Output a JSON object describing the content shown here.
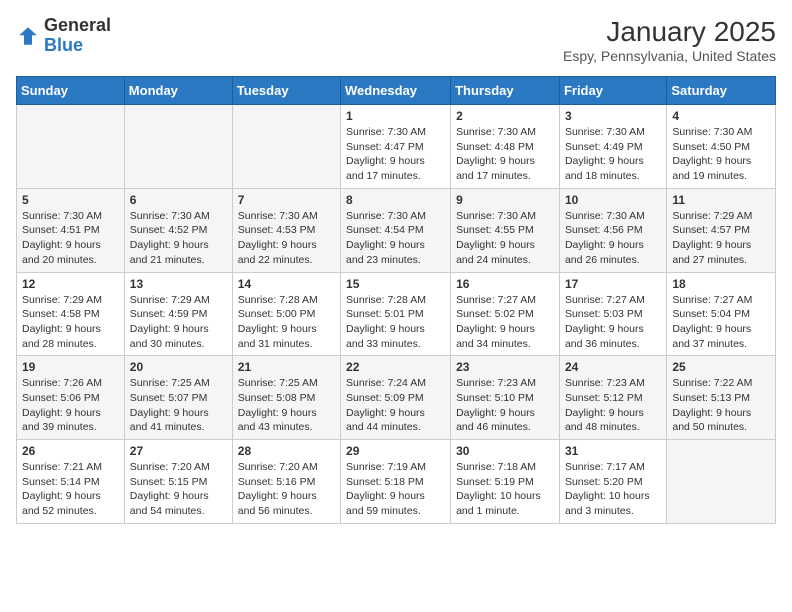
{
  "header": {
    "logo_line1": "General",
    "logo_line2": "Blue",
    "title": "January 2025",
    "subtitle": "Espy, Pennsylvania, United States"
  },
  "days_of_week": [
    "Sunday",
    "Monday",
    "Tuesday",
    "Wednesday",
    "Thursday",
    "Friday",
    "Saturday"
  ],
  "weeks": [
    [
      {
        "day": "",
        "content": ""
      },
      {
        "day": "",
        "content": ""
      },
      {
        "day": "",
        "content": ""
      },
      {
        "day": "1",
        "content": "Sunrise: 7:30 AM\nSunset: 4:47 PM\nDaylight: 9 hours\nand 17 minutes."
      },
      {
        "day": "2",
        "content": "Sunrise: 7:30 AM\nSunset: 4:48 PM\nDaylight: 9 hours\nand 17 minutes."
      },
      {
        "day": "3",
        "content": "Sunrise: 7:30 AM\nSunset: 4:49 PM\nDaylight: 9 hours\nand 18 minutes."
      },
      {
        "day": "4",
        "content": "Sunrise: 7:30 AM\nSunset: 4:50 PM\nDaylight: 9 hours\nand 19 minutes."
      }
    ],
    [
      {
        "day": "5",
        "content": "Sunrise: 7:30 AM\nSunset: 4:51 PM\nDaylight: 9 hours\nand 20 minutes."
      },
      {
        "day": "6",
        "content": "Sunrise: 7:30 AM\nSunset: 4:52 PM\nDaylight: 9 hours\nand 21 minutes."
      },
      {
        "day": "7",
        "content": "Sunrise: 7:30 AM\nSunset: 4:53 PM\nDaylight: 9 hours\nand 22 minutes."
      },
      {
        "day": "8",
        "content": "Sunrise: 7:30 AM\nSunset: 4:54 PM\nDaylight: 9 hours\nand 23 minutes."
      },
      {
        "day": "9",
        "content": "Sunrise: 7:30 AM\nSunset: 4:55 PM\nDaylight: 9 hours\nand 24 minutes."
      },
      {
        "day": "10",
        "content": "Sunrise: 7:30 AM\nSunset: 4:56 PM\nDaylight: 9 hours\nand 26 minutes."
      },
      {
        "day": "11",
        "content": "Sunrise: 7:29 AM\nSunset: 4:57 PM\nDaylight: 9 hours\nand 27 minutes."
      }
    ],
    [
      {
        "day": "12",
        "content": "Sunrise: 7:29 AM\nSunset: 4:58 PM\nDaylight: 9 hours\nand 28 minutes."
      },
      {
        "day": "13",
        "content": "Sunrise: 7:29 AM\nSunset: 4:59 PM\nDaylight: 9 hours\nand 30 minutes."
      },
      {
        "day": "14",
        "content": "Sunrise: 7:28 AM\nSunset: 5:00 PM\nDaylight: 9 hours\nand 31 minutes."
      },
      {
        "day": "15",
        "content": "Sunrise: 7:28 AM\nSunset: 5:01 PM\nDaylight: 9 hours\nand 33 minutes."
      },
      {
        "day": "16",
        "content": "Sunrise: 7:27 AM\nSunset: 5:02 PM\nDaylight: 9 hours\nand 34 minutes."
      },
      {
        "day": "17",
        "content": "Sunrise: 7:27 AM\nSunset: 5:03 PM\nDaylight: 9 hours\nand 36 minutes."
      },
      {
        "day": "18",
        "content": "Sunrise: 7:27 AM\nSunset: 5:04 PM\nDaylight: 9 hours\nand 37 minutes."
      }
    ],
    [
      {
        "day": "19",
        "content": "Sunrise: 7:26 AM\nSunset: 5:06 PM\nDaylight: 9 hours\nand 39 minutes."
      },
      {
        "day": "20",
        "content": "Sunrise: 7:25 AM\nSunset: 5:07 PM\nDaylight: 9 hours\nand 41 minutes."
      },
      {
        "day": "21",
        "content": "Sunrise: 7:25 AM\nSunset: 5:08 PM\nDaylight: 9 hours\nand 43 minutes."
      },
      {
        "day": "22",
        "content": "Sunrise: 7:24 AM\nSunset: 5:09 PM\nDaylight: 9 hours\nand 44 minutes."
      },
      {
        "day": "23",
        "content": "Sunrise: 7:23 AM\nSunset: 5:10 PM\nDaylight: 9 hours\nand 46 minutes."
      },
      {
        "day": "24",
        "content": "Sunrise: 7:23 AM\nSunset: 5:12 PM\nDaylight: 9 hours\nand 48 minutes."
      },
      {
        "day": "25",
        "content": "Sunrise: 7:22 AM\nSunset: 5:13 PM\nDaylight: 9 hours\nand 50 minutes."
      }
    ],
    [
      {
        "day": "26",
        "content": "Sunrise: 7:21 AM\nSunset: 5:14 PM\nDaylight: 9 hours\nand 52 minutes."
      },
      {
        "day": "27",
        "content": "Sunrise: 7:20 AM\nSunset: 5:15 PM\nDaylight: 9 hours\nand 54 minutes."
      },
      {
        "day": "28",
        "content": "Sunrise: 7:20 AM\nSunset: 5:16 PM\nDaylight: 9 hours\nand 56 minutes."
      },
      {
        "day": "29",
        "content": "Sunrise: 7:19 AM\nSunset: 5:18 PM\nDaylight: 9 hours\nand 59 minutes."
      },
      {
        "day": "30",
        "content": "Sunrise: 7:18 AM\nSunset: 5:19 PM\nDaylight: 10 hours\nand 1 minute."
      },
      {
        "day": "31",
        "content": "Sunrise: 7:17 AM\nSunset: 5:20 PM\nDaylight: 10 hours\nand 3 minutes."
      },
      {
        "day": "",
        "content": ""
      }
    ]
  ]
}
